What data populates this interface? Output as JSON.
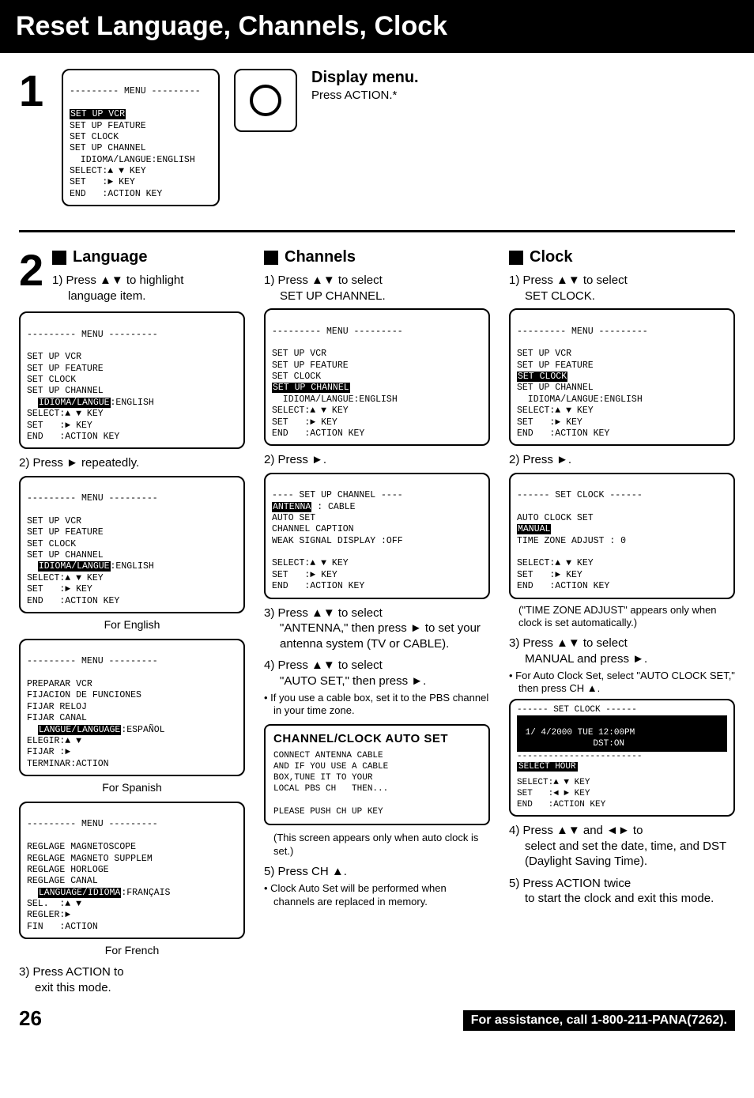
{
  "title": "Reset Language, Channels, Clock",
  "step1": {
    "num": "1",
    "display_heading": "Display menu.",
    "display_sub": "Press ACTION.*",
    "osd": {
      "header": "--------- MENU ---------",
      "hl": "SET UP VCR",
      "lines": "SET UP FEATURE\nSET CLOCK\nSET UP CHANNEL\n  IDIOMA/LANGUE:ENGLISH\nSELECT:▲ ▼ KEY\nSET   :► KEY\nEND   :ACTION KEY"
    }
  },
  "step2_num": "2",
  "language": {
    "heading": "Language",
    "s1": "1) Press ▲▼ to highlight",
    "s1b": "language item.",
    "osd1": {
      "header": "--------- MENU ---------",
      "pre": "SET UP VCR\nSET UP FEATURE\nSET CLOCK\nSET UP CHANNEL",
      "hl": "IDIOMA/LANGUE",
      "hl_tail": ":ENGLISH",
      "post": "SELECT:▲ ▼ KEY\nSET   :► KEY\nEND   :ACTION KEY"
    },
    "s2": "2) Press ► repeatedly.",
    "osd_en": {
      "header": "--------- MENU ---------",
      "pre": "SET UP VCR\nSET UP FEATURE\nSET CLOCK\nSET UP CHANNEL",
      "hl": "IDIOMA/LANGUE",
      "hl_tail": ":ENGLISH",
      "post": "SELECT:▲ ▼ KEY\nSET   :► KEY\nEND   :ACTION KEY"
    },
    "cap_en": "For English",
    "osd_es": {
      "header": "--------- MENU ---------",
      "pre": "PREPARAR VCR\nFIJACION DE FUNCIONES\nFIJAR RELOJ\nFIJAR CANAL",
      "hl": "LANGUE/LANGUAGE",
      "hl_tail": ":ESPAÑOL",
      "post": "ELEGIR:▲ ▼\nFIJAR :►\nTERMINAR:ACTION"
    },
    "cap_es": "For Spanish",
    "osd_fr": {
      "header": "--------- MENU ---------",
      "pre": "REGLAGE MAGNETOSCOPE\nREGLAGE MAGNETO SUPPLEM\nREGLAGE HORLOGE\nREGLAGE CANAL",
      "hl": "LANGUAGE/IDIOMA",
      "hl_tail": ":FRANÇAIS",
      "post": "SEL.  :▲ ▼\nREGLER:►\nFIN   :ACTION"
    },
    "cap_fr": "For French",
    "s3": "3) Press ACTION to",
    "s3b": "exit this mode."
  },
  "channels": {
    "heading": "Channels",
    "s1": "1) Press ▲▼ to select",
    "s1b": "SET UP CHANNEL.",
    "osd1": {
      "header": "--------- MENU ---------",
      "pre": "SET UP VCR\nSET UP FEATURE\nSET CLOCK",
      "hl": "SET UP CHANNEL",
      "post": "  IDIOMA/LANGUE:ENGLISH\nSELECT:▲ ▼ KEY\nSET   :► KEY\nEND   :ACTION KEY"
    },
    "s2": "2) Press ►.",
    "osd2": {
      "header": "---- SET UP CHANNEL ----",
      "hl": "ANTENNA",
      "hl_tail": " : CABLE",
      "post": "AUTO SET\nCHANNEL CAPTION\nWEAK SIGNAL DISPLAY :OFF\n\nSELECT:▲ ▼ KEY\nSET   :► KEY\nEND   :ACTION KEY"
    },
    "s3": "3) Press ▲▼ to select",
    "s3b": "\"ANTENNA,\" then press ► to set your antenna system (TV or CABLE).",
    "s4": "4) Press ▲▼ to select",
    "s4b": "\"AUTO SET,\" then press ►.",
    "s4note": "If you use a cable box, set it to the PBS channel in your time zone.",
    "autoset_title": "CHANNEL/CLOCK AUTO SET",
    "autoset_body": "CONNECT ANTENNA CABLE\nAND IF YOU USE A CABLE\nBOX,TUNE IT TO YOUR\nLOCAL PBS CH   THEN...\n\nPLEASE PUSH CH UP KEY",
    "autoset_caption": "(This screen appears only when auto clock is set.)",
    "s5": "5) Press CH ▲.",
    "s5note": "Clock Auto Set will be performed when channels are replaced in memory."
  },
  "clock": {
    "heading": "Clock",
    "s1": "1) Press ▲▼ to select",
    "s1b": "SET CLOCK.",
    "osd1": {
      "header": "--------- MENU ---------",
      "pre": "SET UP VCR\nSET UP FEATURE",
      "hl": "SET CLOCK",
      "post": "SET UP CHANNEL\n  IDIOMA/LANGUE:ENGLISH\nSELECT:▲ ▼ KEY\nSET   :► KEY\nEND   :ACTION KEY"
    },
    "s2": "2) Press ►.",
    "osd2": {
      "header": "------ SET CLOCK ------",
      "pre": "\nAUTO CLOCK SET",
      "hl": "MANUAL",
      "post": "TIME ZONE ADJUST : 0\n\nSELECT:▲ ▼ KEY\nSET   :► KEY\nEND   :ACTION KEY"
    },
    "tz_note": "(\"TIME ZONE ADJUST\" appears only when clock is set automatically.)",
    "s3": "3) Press ▲▼ to select",
    "s3b": "MANUAL and press ►.",
    "s3note": "For Auto Clock Set, select \"AUTO CLOCK SET,\" then press CH ▲.",
    "osd3_header": "------ SET CLOCK ------",
    "osd3_date": " 1/ 4/2000 TUE 12:00PM",
    "osd3_dst": "              DST:ON",
    "osd3_hl": "SELECT HOUR",
    "osd3_post": "SELECT:▲ ▼ KEY\nSET   :◄ ► KEY\nEND   :ACTION KEY",
    "s4": "4) Press ▲▼ and ◄► to",
    "s4b": "select and set the date, time, and DST (Daylight Saving Time).",
    "s5": "5) Press ACTION twice",
    "s5b": "to start the clock and exit this mode."
  },
  "footer": {
    "page": "26",
    "assist": "For assistance, call 1-800-211-PANA(7262)."
  }
}
